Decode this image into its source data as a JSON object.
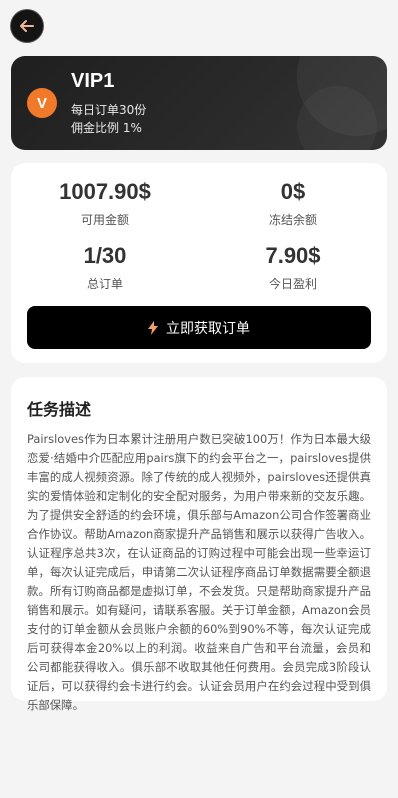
{
  "vip": {
    "badge": "V",
    "level": "VIP1",
    "daily_orders": "每日订单30份",
    "commission": "佣金比例 1%"
  },
  "stats": [
    {
      "value": "1007.90$",
      "label": "可用金额"
    },
    {
      "value": "0$",
      "label": "冻结余额"
    },
    {
      "value": "1/30",
      "label": "总订单"
    },
    {
      "value": "7.90$",
      "label": "今日盈利"
    }
  ],
  "actions": {
    "get_orders_label": "立即获取订单"
  },
  "task": {
    "title": "任务描述",
    "body": "Pairsloves作为日本累计注册用户数已突破100万！作为日本最大级恋爱·结婚中介匹配应用pairs旗下的约会平台之一，pairsloves提供丰富的成人视频资源。除了传统的成人视频外，pairsloves还提供真实的爱情体验和定制化的安全配对服务，为用户带来新的交友乐趣。为了提供安全舒适的约会环境，俱乐部与Amazon公司合作签署商业合作协议。帮助Amazon商家提升产品销售和展示以获得广告收入。认证程序总共3次，在认证商品的订购过程中可能会出现一些幸运订单，每次认证完成后，申请第二次认证程序商品订单数据需要全额退款。所有订购商品都是虚拟订单，不会发货。只是帮助商家提升产品销售和展示。如有疑问，请联系客服。关于订单金额，Amazon会员支付的订单金额从会员账户余额的60%到90%不等，每次认证完成后可获得本金20%以上的利润。收益来自广告和平台流量，会员和公司都能获得收入。俱乐部不收取其他任何费用。会员完成3阶段认证后，可以获得约会卡进行约会。认证会员用户在约会过程中受到俱乐部保障。"
  },
  "colors": {
    "accent_orange": "#f07a2a",
    "dark": "#1f1f1f",
    "button": "#000000"
  },
  "icons": {
    "back": "arrow-left-icon",
    "bolt": "lightning-icon"
  }
}
